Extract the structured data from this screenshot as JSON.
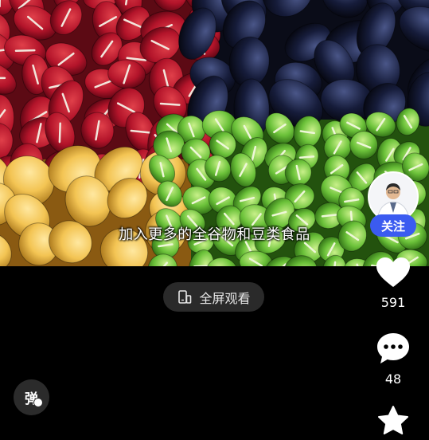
{
  "video": {
    "caption": "加入更多的全谷物和豆类食品"
  },
  "author": {
    "follow_label": "关注"
  },
  "actions": {
    "like_count": "591",
    "comment_count": "48"
  },
  "player": {
    "fullscreen_label": "全屏观看"
  },
  "danmu": {
    "label": "弹"
  },
  "colors": {
    "follow_button": "#3b5bf0",
    "fullscreen_button_bg": "#2a2a2a",
    "background": "#000000"
  },
  "icons": [
    "fullscreen-icon",
    "heart-icon",
    "comment-icon",
    "star-icon",
    "danmu-icon"
  ]
}
